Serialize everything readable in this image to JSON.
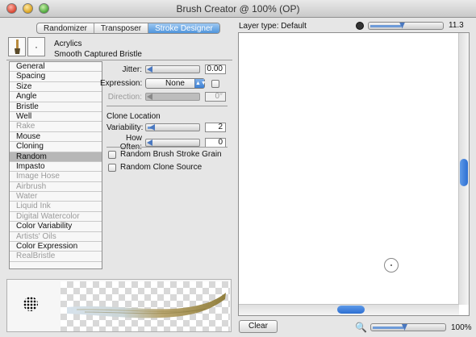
{
  "window": {
    "title": "Brush Creator @ 100% (OP)"
  },
  "tabs": [
    {
      "label": "Randomizer"
    },
    {
      "label": "Transposer"
    },
    {
      "label": "Stroke Designer"
    }
  ],
  "brush": {
    "category": "Acrylics",
    "variant": "Smooth Captured Bristle"
  },
  "categories": [
    {
      "label": "General",
      "enabled": true
    },
    {
      "label": "Spacing",
      "enabled": true
    },
    {
      "label": "Size",
      "enabled": true
    },
    {
      "label": "Angle",
      "enabled": true
    },
    {
      "label": "Bristle",
      "enabled": true
    },
    {
      "label": "Well",
      "enabled": true
    },
    {
      "label": "Rake",
      "enabled": false
    },
    {
      "label": "Mouse",
      "enabled": true
    },
    {
      "label": "Cloning",
      "enabled": true
    },
    {
      "label": "Random",
      "enabled": true,
      "selected": true
    },
    {
      "label": "Impasto",
      "enabled": true
    },
    {
      "label": "Image Hose",
      "enabled": false
    },
    {
      "label": "Airbrush",
      "enabled": false
    },
    {
      "label": "Water",
      "enabled": false
    },
    {
      "label": "Liquid Ink",
      "enabled": false
    },
    {
      "label": "Digital Watercolor",
      "enabled": false
    },
    {
      "label": "Color Variability",
      "enabled": true
    },
    {
      "label": "Artists' Oils",
      "enabled": false
    },
    {
      "label": "Color Expression",
      "enabled": true
    },
    {
      "label": "RealBristle",
      "enabled": false
    }
  ],
  "controls": {
    "jitter": {
      "label": "Jitter:",
      "value": "0.00"
    },
    "expression": {
      "label": "Expression:",
      "value": "None"
    },
    "direction": {
      "label": "Direction:",
      "value": "0°"
    },
    "clone_location": "Clone Location",
    "variability": {
      "label": "Variability:",
      "value": "2"
    },
    "how_often": {
      "label": "How Often:",
      "value": "0"
    },
    "random_grain": "Random Brush Stroke Grain",
    "random_clone": "Random Clone Source"
  },
  "right": {
    "layer_type": "Layer type: Default",
    "brush_size": "11.3",
    "clear_label": "Clear",
    "zoom": "100%"
  }
}
